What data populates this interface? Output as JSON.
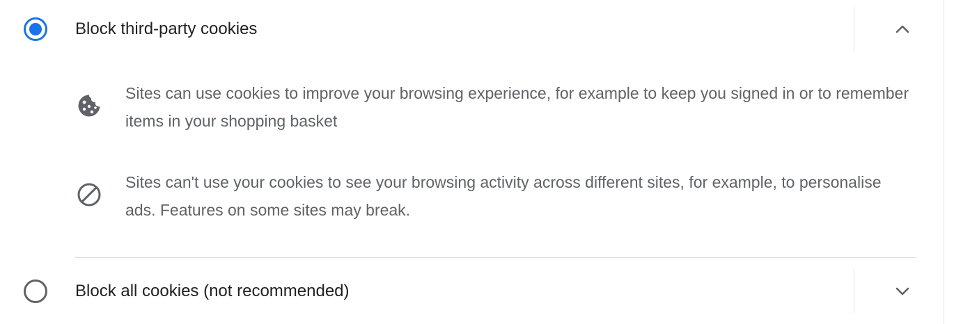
{
  "options": [
    {
      "label": "Block third-party cookies",
      "selected": true,
      "expanded": true,
      "toggle_icon": "chevron-up-icon"
    },
    {
      "label": "Block all cookies (not recommended)",
      "selected": false,
      "expanded": false,
      "toggle_icon": "chevron-down-icon"
    }
  ],
  "details": [
    {
      "icon": "cookie-icon",
      "text": "Sites can use cookies to improve your browsing experience, for example to keep you signed in or to remember items in your shopping basket"
    },
    {
      "icon": "block-icon",
      "text": "Sites can't use your cookies to see your browsing activity across different sites, for example, to personalise ads. Features on some sites may break."
    }
  ],
  "colors": {
    "accent": "#1a73e8",
    "primary_text": "#202124",
    "secondary_text": "#5f6368",
    "divider": "#e0e0e0"
  }
}
